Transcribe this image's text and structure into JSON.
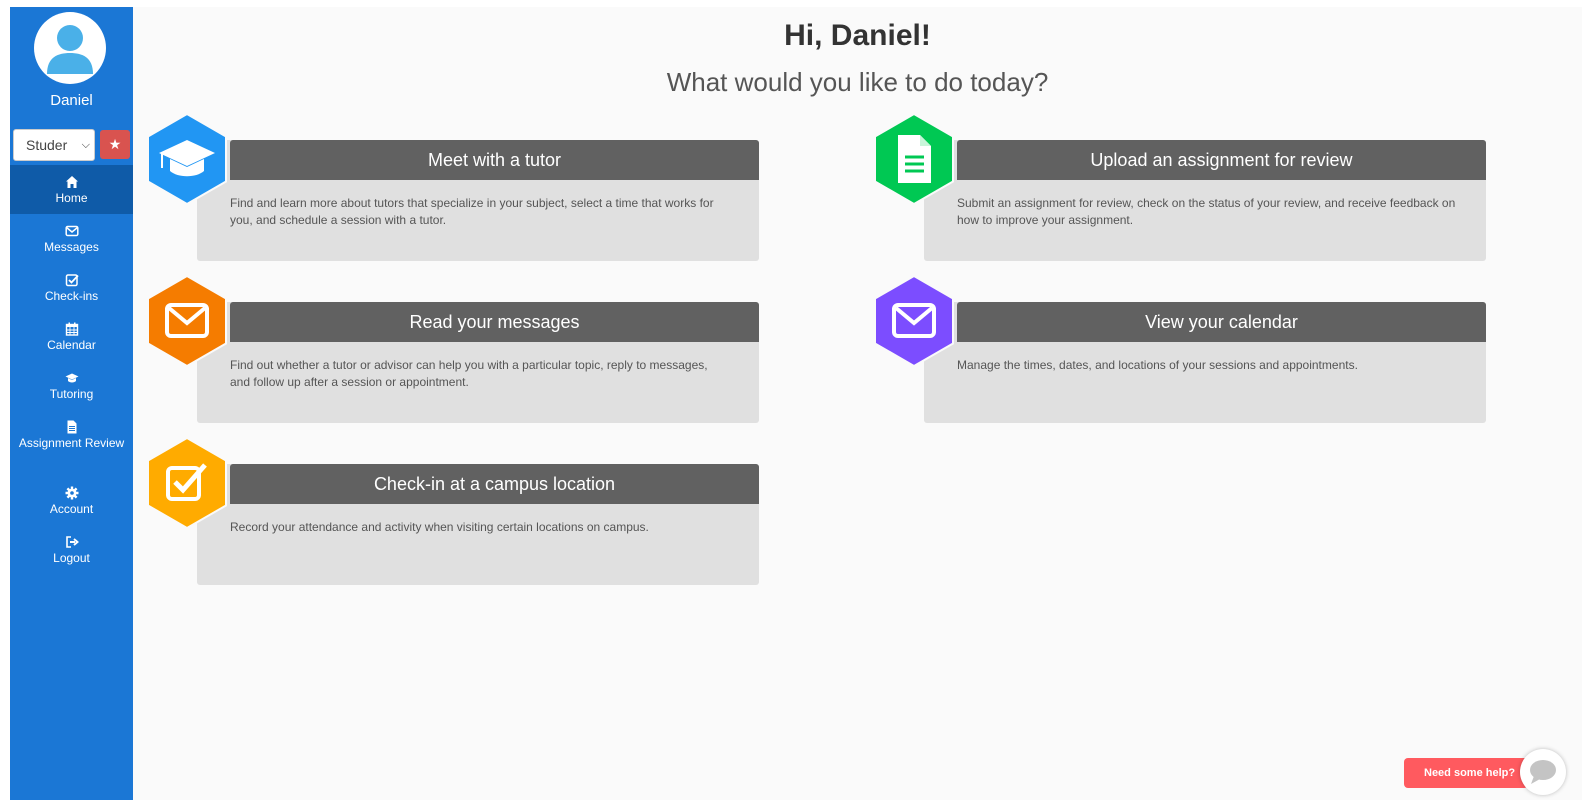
{
  "user": {
    "name": "Daniel"
  },
  "role_select": {
    "value": "Studer"
  },
  "nav": [
    {
      "label": "Home",
      "icon": "home-icon",
      "active": true
    },
    {
      "label": "Messages",
      "icon": "envelope-icon"
    },
    {
      "label": "Check-ins",
      "icon": "checkbox-icon"
    },
    {
      "label": "Calendar",
      "icon": "calendar-icon"
    },
    {
      "label": "Tutoring",
      "icon": "graduation-cap-icon"
    },
    {
      "label": "Assignment Review",
      "icon": "document-icon"
    },
    {
      "label": "Account",
      "icon": "gear-icon"
    },
    {
      "label": "Logout",
      "icon": "logout-icon"
    }
  ],
  "header": {
    "greeting": "Hi, Daniel!",
    "subtitle": "What would you like to do today?"
  },
  "cards": [
    {
      "title": "Meet with a tutor",
      "description": "Find and learn more about tutors that specialize in your subject, select a time that works for you, and schedule a session with a tutor.",
      "icon": "graduation-cap-icon",
      "color": "#2196f3"
    },
    {
      "title": "Upload an assignment for review",
      "description": "Submit an assignment for review, check on the status of your review, and receive feedback on how to improve your assignment.",
      "icon": "document-icon",
      "color": "#00c853"
    },
    {
      "title": "Read your messages",
      "description": "Find out whether a tutor or advisor can help you with a particular topic, reply to messages, and follow up after a session or appointment.",
      "icon": "envelope-icon",
      "color": "#f57c00"
    },
    {
      "title": "View your calendar",
      "description": "Manage the times, dates, and locations of your sessions and appointments.",
      "icon": "envelope-icon",
      "color": "#7c4dff"
    },
    {
      "title": "Check-in at a campus location",
      "description": "Record your attendance and activity when visiting certain locations on campus.",
      "icon": "checkbox-icon",
      "color": "#ffab00"
    }
  ],
  "help": {
    "label": "Need some help?",
    "icon": "chat-bubble-icon",
    "color": "#ff5a5f"
  },
  "colors": {
    "sidebar": "#1b77d5",
    "sidebar_active": "#0f5ba8",
    "card_header": "#616161",
    "card_body": "#e0e0e0",
    "favorite": "#d9534f"
  }
}
